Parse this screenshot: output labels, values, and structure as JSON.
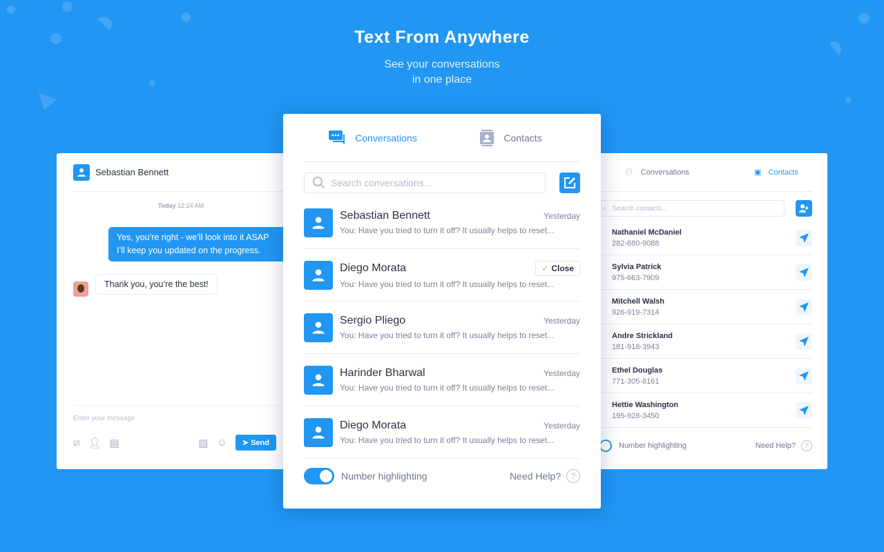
{
  "hero": {
    "title": "Text From Anywhere",
    "subtitle": "See your conversations\nin one place"
  },
  "colors": {
    "accent": "#2196f3",
    "background": "#2196f3"
  },
  "chat": {
    "contact": "Sebastian Bennett",
    "date_day": "Today",
    "date_time": "12:24 AM",
    "outgoing": "Yes, you’re right - we’ll look into it ASAP\nI’ll keep you updated on the progress.",
    "incoming": "Thank you, you’re the best!",
    "input_placeholder": "Enter your message",
    "send_label": "Send"
  },
  "main": {
    "tabs": [
      {
        "label": "Conversations",
        "icon": "chat-bubbles-icon",
        "active": true
      },
      {
        "label": "Contacts",
        "icon": "contact-card-icon",
        "active": false
      }
    ],
    "search_placeholder": "Search conversations...",
    "conversations": [
      {
        "name": "Sebastian Bennett",
        "date": "Yesterday",
        "preview": "You: Have you tried to turn it off? It usually helps to reset..."
      },
      {
        "name": "Diego Morata",
        "action": "Close",
        "preview": "You: Have you tried to turn it off? It usually helps to reset..."
      },
      {
        "name": "Sergio Pliego",
        "date": "Yesterday",
        "preview": "You: Have you tried to turn it off? It usually helps to reset..."
      },
      {
        "name": "Harinder Bharwal",
        "date": "Yesterday",
        "preview": "You: Have you tried to turn it off? It usually helps to reset..."
      },
      {
        "name": "Diego Morata",
        "date": "Yesterday",
        "preview": "You: Have you tried to turn it off? It usually helps to reset..."
      }
    ],
    "toggle_label": "Number highlighting",
    "toggle_on": true,
    "help": "Need Help?"
  },
  "contacts_panel": {
    "tabs": [
      {
        "label": "Conversations",
        "active": false
      },
      {
        "label": "Contacts",
        "active": true
      }
    ],
    "search_placeholder": "Search contacts...",
    "contacts": [
      {
        "name": "Nathaniel McDaniel",
        "phone": "282-680-9088"
      },
      {
        "name": "Sylvia Patrick",
        "phone": "975-663-7909"
      },
      {
        "name": "Mitchell Walsh",
        "phone": "926-919-7314"
      },
      {
        "name": "Andre Strickland",
        "phone": "181-918-3943"
      },
      {
        "name": "Ethel Douglas",
        "phone": "771-305-8161"
      },
      {
        "name": "Hettie Washington",
        "phone": "195-928-3450"
      }
    ],
    "toggle_label": "Number highlighting",
    "toggle_on": false,
    "help": "Need Help?"
  }
}
